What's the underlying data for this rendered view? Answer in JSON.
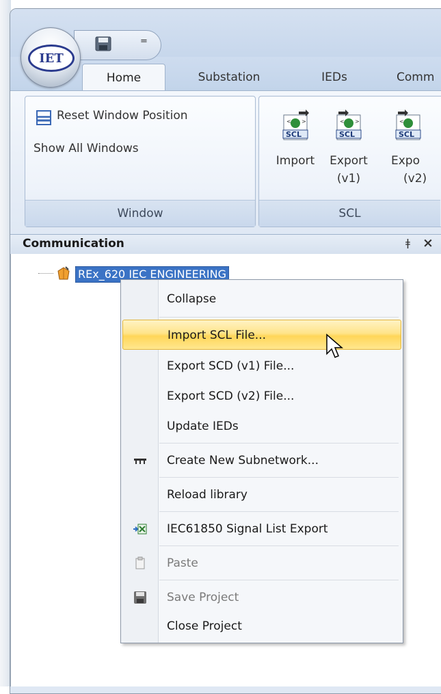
{
  "app": {
    "logo_text": "IET",
    "qat_dropdown": "="
  },
  "tabs": [
    {
      "label": "Home"
    },
    {
      "label": "Substation"
    },
    {
      "label": "IEDs"
    },
    {
      "label": "Comm"
    }
  ],
  "ribbon": {
    "window_group": {
      "reset_label": "Reset Window Position",
      "show_all_label": "Show All Windows",
      "group_label": "Window"
    },
    "scl_group": {
      "buttons": [
        {
          "line1": "Import",
          "line2": ""
        },
        {
          "line1": "Export",
          "line2": "(v1)"
        },
        {
          "line1": "Expo",
          "line2": "(v2)"
        }
      ],
      "icon_text": "SCL",
      "group_label": "SCL"
    }
  },
  "panel": {
    "title": "Communication",
    "pin": "ǂ",
    "close": "×"
  },
  "tree": {
    "root_label": "REx_620 IEC ENGINEERING"
  },
  "context_menu": {
    "items": [
      {
        "label": "Collapse",
        "icon": "",
        "disabled": false
      },
      {
        "label": "Import SCL File...",
        "icon": "",
        "disabled": false,
        "highlighted": true
      },
      {
        "label": "Export SCD (v1) File...",
        "icon": "",
        "disabled": false
      },
      {
        "label": "Export SCD (v2) File...",
        "icon": "",
        "disabled": false
      },
      {
        "label": "Update IEDs",
        "icon": "",
        "disabled": false
      },
      {
        "label": "Create New Subnetwork...",
        "icon": "subnetwork-icon",
        "disabled": false
      },
      {
        "label": "Reload library",
        "icon": "",
        "disabled": false
      },
      {
        "label": "IEC61850 Signal List Export",
        "icon": "excel-export-icon",
        "disabled": false
      },
      {
        "label": "Paste",
        "icon": "clipboard-icon",
        "disabled": true
      },
      {
        "label": "Save Project",
        "icon": "save-icon",
        "disabled": true
      },
      {
        "label": "Close Project",
        "icon": "",
        "disabled": false
      }
    ]
  },
  "colors": {
    "selection": "#3b73c5",
    "highlight": "#ffe48a",
    "ribbon": "#dfe8f4"
  }
}
